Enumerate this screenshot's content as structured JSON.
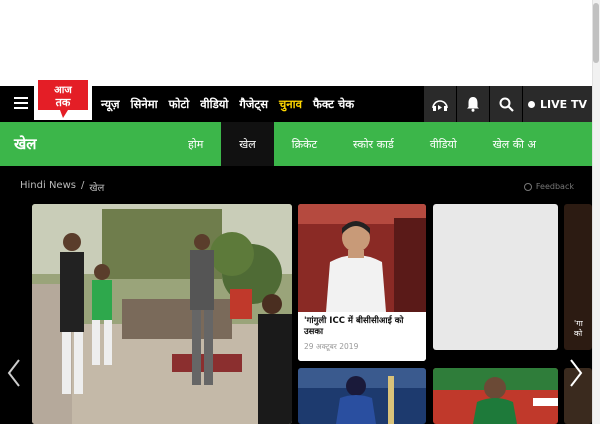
{
  "header": {
    "logo_text": "आज तक",
    "nav_links": [
      "न्यूज़",
      "सिनेमा",
      "फोटो",
      "वीडियो",
      "गैजेट्स",
      "चुनाव",
      "फैक्ट चेक"
    ],
    "highlight_link": "चुनाव",
    "live_tv_label": "LIVE TV",
    "icons": [
      "menu-icon",
      "audio-icon",
      "bell-icon",
      "search-icon"
    ]
  },
  "section": {
    "title": "खेल",
    "tabs": [
      "होम",
      "खेल",
      "क्रिकेट",
      "स्कोर कार्ड",
      "वीडियो",
      "खेल की अ"
    ],
    "active_tab": "खेल"
  },
  "breadcrumb": {
    "home": "Hindi News",
    "separator": "/",
    "current": "खेल"
  },
  "feedback_label": "Feedback",
  "stories": {
    "ganguly": {
      "headline": "'गांगुली ICC में बीसीसीआई को उसका",
      "date": "29 अक्टूबर 2019"
    },
    "edge_caption": "'गा को"
  },
  "colors": {
    "brand_red": "#e41e26",
    "section_green": "#3cb64a",
    "nav_black": "#000000",
    "highlight_yellow": "#ffd700"
  }
}
